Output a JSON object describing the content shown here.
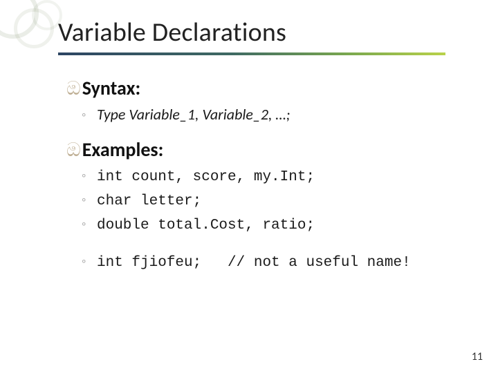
{
  "title": "Variable Declarations",
  "bullet_glyph": "ၹ9",
  "swirl_glyph": "ඔ",
  "ring_glyph": "◦",
  "sections": {
    "syntax": {
      "heading": "Syntax:",
      "line": "Type Variable_1, Variable_2, …;"
    },
    "examples": {
      "heading": "Examples:",
      "lines": [
        "int count, score, my.Int;",
        "char letter;",
        "double total.Cost, ratio;"
      ],
      "bad_line_code": "int fjiofeu;",
      "bad_line_comment": "// not a useful name!"
    }
  },
  "page_number": "11"
}
